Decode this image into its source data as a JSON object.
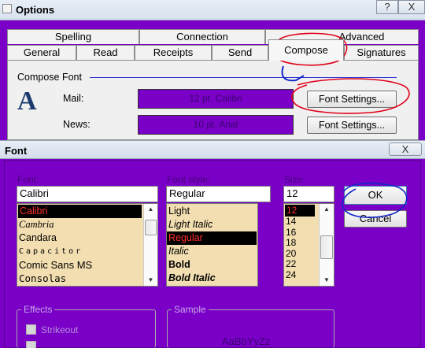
{
  "options": {
    "title": "Options",
    "caption_help": "?",
    "caption_close": "X",
    "tabs_row1": [
      "Spelling",
      "Connection",
      "Advanced"
    ],
    "tabs_row2": [
      "General",
      "Read",
      "Receipts",
      "Send",
      "Compose",
      "Signatures"
    ],
    "active_tab": "Compose",
    "section_title": "Compose Font",
    "mail_label": "Mail:",
    "mail_value": "12 pt. Calibri",
    "news_label": "News:",
    "news_value": "10 pt. Arial",
    "font_settings_label": "Font Settings...",
    "font_icon_glyph": "A"
  },
  "font_dialog": {
    "title": "Font",
    "close_label": "X",
    "font_label": "Font:",
    "font_value": "Calibri",
    "fonts": [
      "Calibri",
      "Cambria",
      "Candara",
      "Capacitor",
      "Comic Sans MS",
      "Consolas"
    ],
    "style_label": "Font style:",
    "style_value": "Regular",
    "styles": [
      "Light",
      "Light Italic",
      "Regular",
      "Italic",
      "Bold",
      "Bold Italic"
    ],
    "size_label": "Size:",
    "size_value": "12",
    "sizes": [
      "12",
      "14",
      "16",
      "18",
      "20",
      "22",
      "24"
    ],
    "ok_label": "OK",
    "cancel_label": "Cancel",
    "effects_label": "Effects",
    "strikeout_label": "Strikeout",
    "sample_label": "Sample",
    "sample_text": "AaBbYyZz"
  },
  "colors": {
    "background": "#7a00c8",
    "list_bg": "#f2deb0",
    "annotation_red": "#e0001a",
    "annotation_blue": "#1428c8"
  }
}
